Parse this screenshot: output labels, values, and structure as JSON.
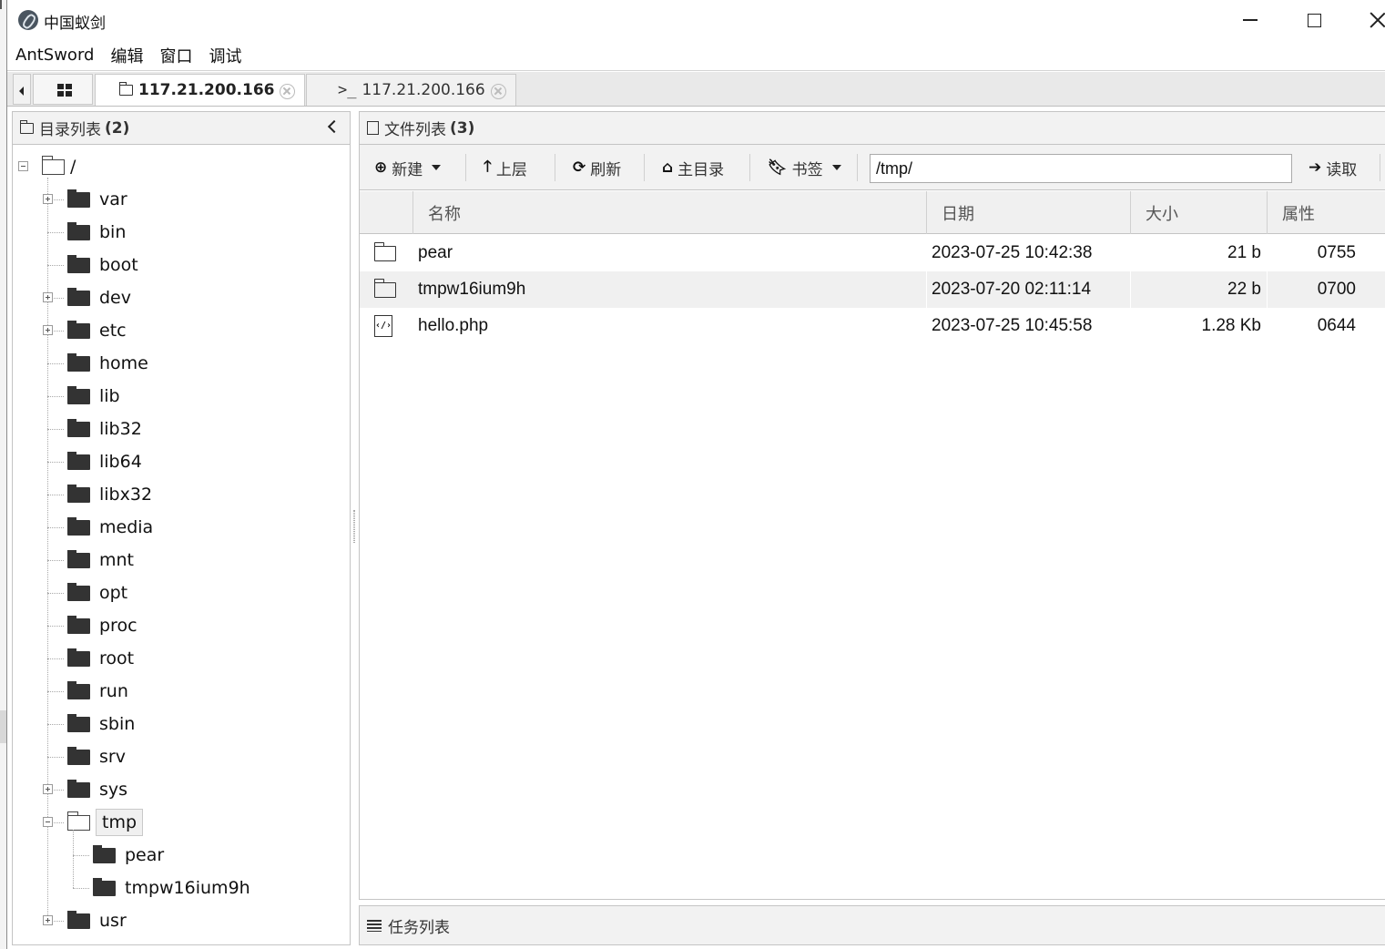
{
  "window": {
    "title": "中国蚁剑"
  },
  "menubar": {
    "items": [
      "AntSword",
      "编辑",
      "窗口",
      "调试"
    ]
  },
  "tabs": {
    "active_label": "117.21.200.166",
    "terminal_prefix": ">_",
    "terminal_label": "117.21.200.166"
  },
  "dir_panel": {
    "title": "目录列表",
    "count": "(2)",
    "root": "/",
    "items": [
      {
        "name": "var",
        "expandable": true
      },
      {
        "name": "bin",
        "expandable": false
      },
      {
        "name": "boot",
        "expandable": false
      },
      {
        "name": "dev",
        "expandable": true
      },
      {
        "name": "etc",
        "expandable": true
      },
      {
        "name": "home",
        "expandable": false
      },
      {
        "name": "lib",
        "expandable": false
      },
      {
        "name": "lib32",
        "expandable": false
      },
      {
        "name": "lib64",
        "expandable": false
      },
      {
        "name": "libx32",
        "expandable": false
      },
      {
        "name": "media",
        "expandable": false
      },
      {
        "name": "mnt",
        "expandable": false
      },
      {
        "name": "opt",
        "expandable": false
      },
      {
        "name": "proc",
        "expandable": false
      },
      {
        "name": "root",
        "expandable": false
      },
      {
        "name": "run",
        "expandable": false
      },
      {
        "name": "sbin",
        "expandable": false
      },
      {
        "name": "srv",
        "expandable": false
      },
      {
        "name": "sys",
        "expandable": true
      },
      {
        "name": "tmp",
        "expandable": true,
        "expanded": true,
        "selected": true
      },
      {
        "name": "usr",
        "expandable": true
      }
    ],
    "tmp_children": [
      "pear",
      "tmpw16ium9h"
    ]
  },
  "file_panel": {
    "title": "文件列表",
    "count": "(3)",
    "toolbar": {
      "new_label": "新建",
      "up_label": "上层",
      "refresh_label": "刷新",
      "home_label": "主目录",
      "bookmark_label": "书签",
      "path_value": "/tmp/",
      "read_label": "读取"
    },
    "columns": [
      "名称",
      "日期",
      "大小",
      "属性"
    ],
    "rows": [
      {
        "icon": "folder-icon",
        "name": "pear",
        "date": "2023-07-25 10:42:38",
        "size": "21 b",
        "perm": "0755"
      },
      {
        "icon": "folder-icon",
        "name": "tmpw16ium9h",
        "date": "2023-07-20 02:11:14",
        "size": "22 b",
        "perm": "0700"
      },
      {
        "icon": "php-file-icon",
        "name": "hello.php",
        "date": "2023-07-25 10:45:58",
        "size": "1.28 Kb",
        "perm": "0644"
      }
    ]
  },
  "task_panel": {
    "title": "任务列表"
  }
}
